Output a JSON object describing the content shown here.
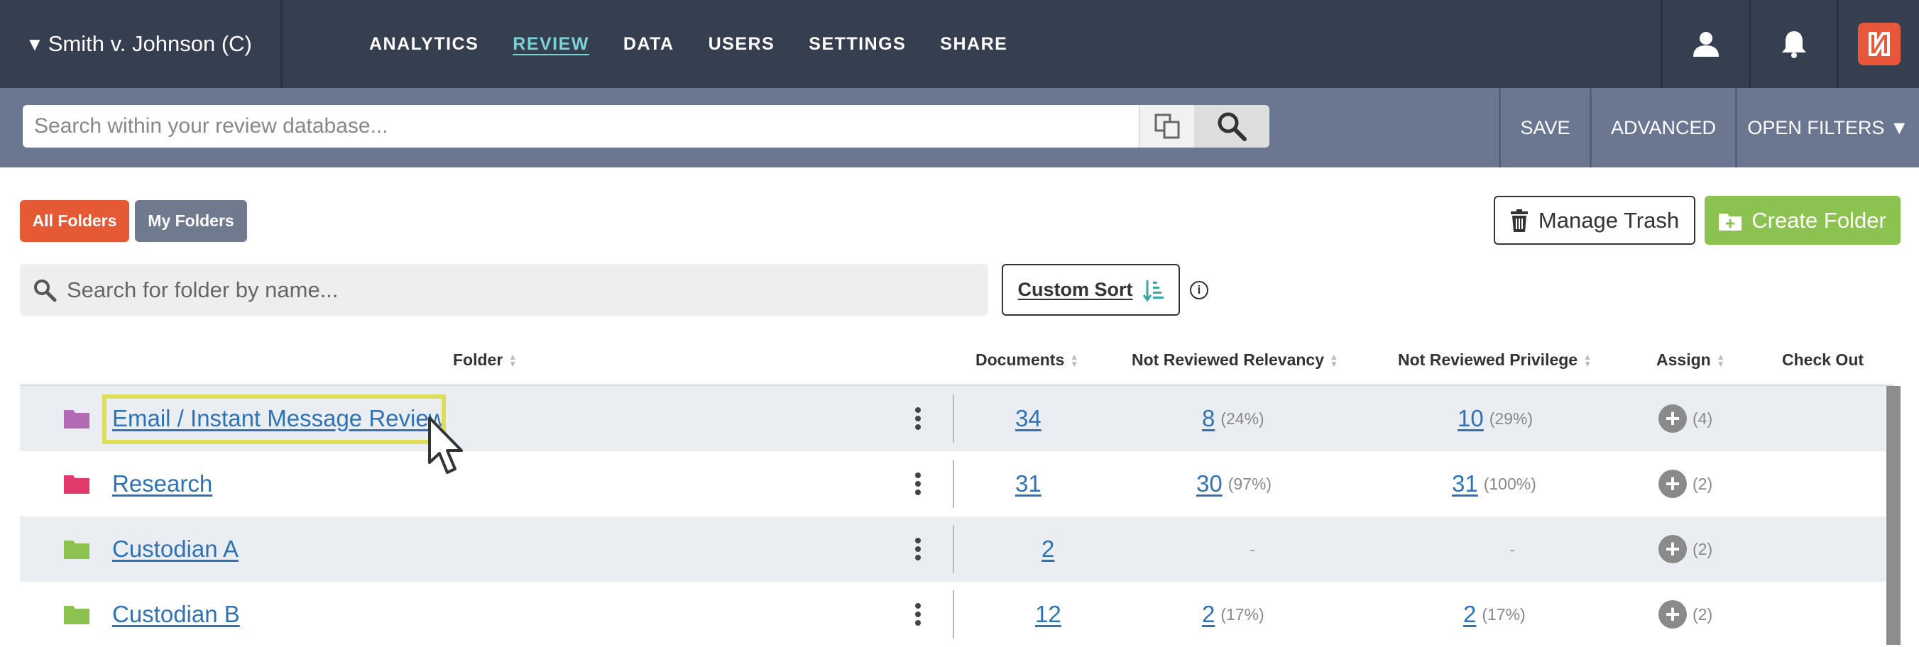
{
  "header": {
    "case_title": "Smith v. Johnson (C)",
    "nav": [
      "ANALYTICS",
      "REVIEW",
      "DATA",
      "USERS",
      "SETTINGS",
      "SHARE"
    ],
    "active_nav": "REVIEW",
    "logo_icon": "brand-logo-icon"
  },
  "searchbar": {
    "placeholder": "Search within your review database...",
    "save_label": "SAVE",
    "advanced_label": "ADVANCED",
    "open_filters_label": "OPEN FILTERS ▼"
  },
  "folders": {
    "all_label": "All Folders",
    "my_label": "My Folders",
    "manage_trash_label": "Manage Trash",
    "create_folder_label": "Create Folder",
    "search_placeholder": "Search for folder by name...",
    "custom_sort_label": "Custom Sort",
    "info_glyph": "i"
  },
  "table": {
    "headers": {
      "folder": "Folder",
      "documents": "Documents",
      "not_reviewed_relevancy": "Not Reviewed Relevancy",
      "not_reviewed_privilege": "Not Reviewed Privilege",
      "assign": "Assign",
      "check_out": "Check Out"
    },
    "rows": [
      {
        "name": "Email / Instant Message Review",
        "folder_color": "#b26ab2",
        "documents": "34",
        "relevancy": "8",
        "relevancy_pct": "(24%)",
        "privilege": "10",
        "privilege_pct": "(29%)",
        "assign_count": "(4)"
      },
      {
        "name": "Research",
        "folder_color": "#e23b6b",
        "documents": "31",
        "relevancy": "30",
        "relevancy_pct": "(97%)",
        "privilege": "31",
        "privilege_pct": "(100%)",
        "assign_count": "(2)"
      },
      {
        "name": "Custodian A",
        "folder_color": "#8cc24f",
        "documents": "2",
        "relevancy": "-",
        "relevancy_pct": "",
        "privilege": "-",
        "privilege_pct": "",
        "assign_count": "(2)"
      },
      {
        "name": "Custodian B",
        "folder_color": "#8cc24f",
        "documents": "12",
        "relevancy": "2",
        "relevancy_pct": "(17%)",
        "privilege": "2",
        "privilege_pct": "(17%)",
        "assign_count": "(2)"
      }
    ]
  }
}
